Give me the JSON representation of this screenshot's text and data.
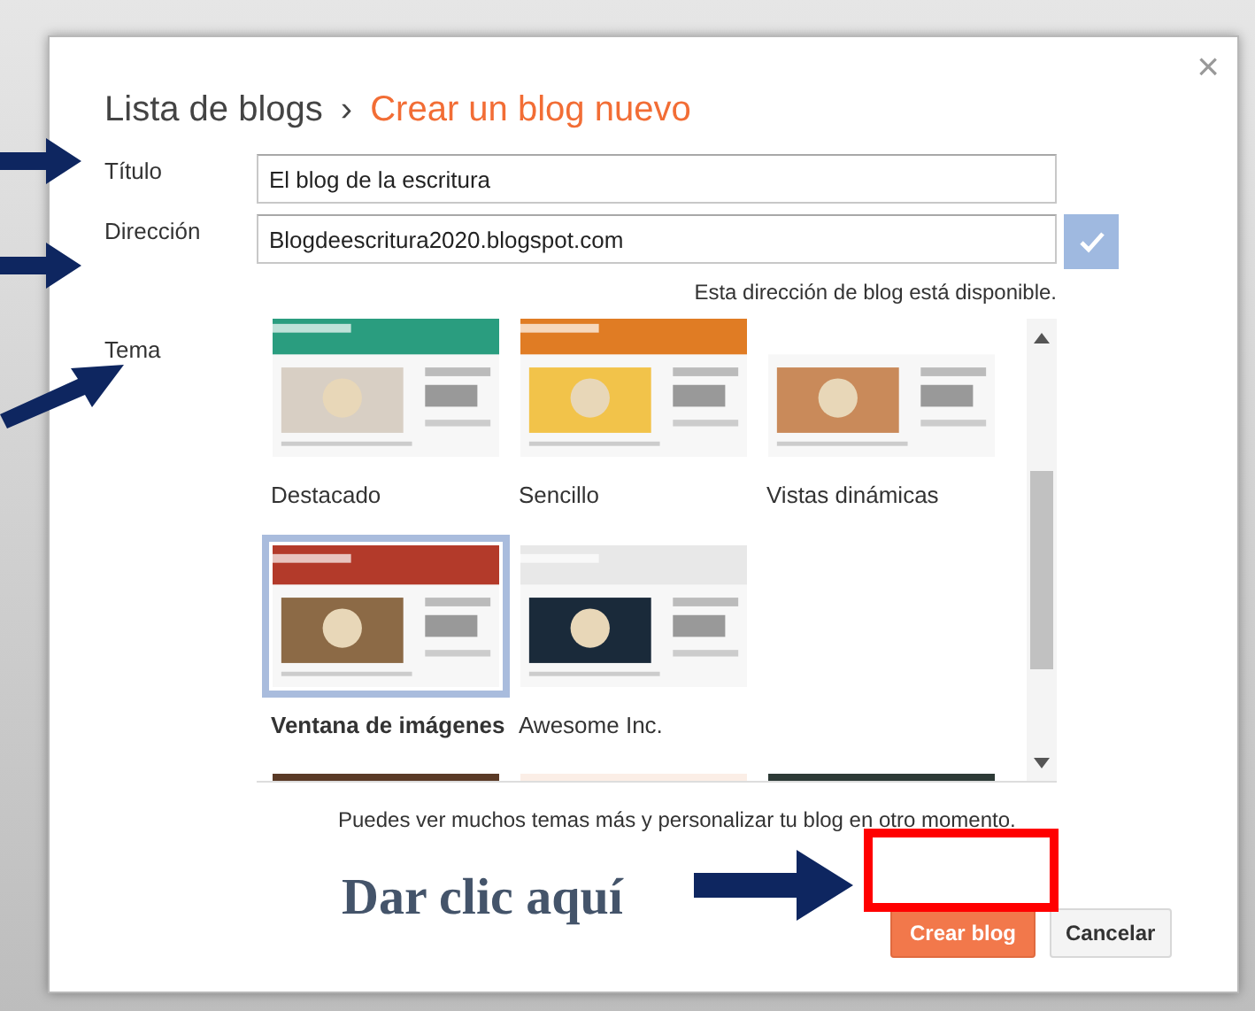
{
  "dialog": {
    "breadcrumb": [
      {
        "label": "Lista de blogs",
        "current": false
      },
      {
        "label": "Crear un blog nuevo",
        "current": true
      }
    ],
    "separator": "›",
    "close": "×",
    "fields": [
      {
        "label": "Título",
        "value": "El blog de la escritura"
      },
      {
        "label": "Dirección",
        "value": "Blogdeescritura2020.blogspot.com",
        "verified": true,
        "hint": "Esta dirección de blog está disponible."
      }
    ],
    "theme": {
      "label": "Tema",
      "themes": [
        {
          "name": "Destacado",
          "selected": false
        },
        {
          "name": "Sencillo",
          "selected": false
        },
        {
          "name": "Vistas dinámicas",
          "selected": false
        },
        {
          "name": "Ventana de imágenes",
          "selected": true
        },
        {
          "name": "Awesome Inc.",
          "selected": false
        },
        {
          "selected": false
        },
        {
          "selected": false
        },
        {
          "selected": false
        }
      ]
    },
    "note": "Puedes ver muchos temas más y personalizar tu blog en otro momento.",
    "buttons": [
      {
        "label": "Crear blog",
        "kind": "primary"
      },
      {
        "label": "Cancelar",
        "kind": "secondary"
      }
    ]
  },
  "annotations": {
    "callout": "Dar clic aquí"
  }
}
